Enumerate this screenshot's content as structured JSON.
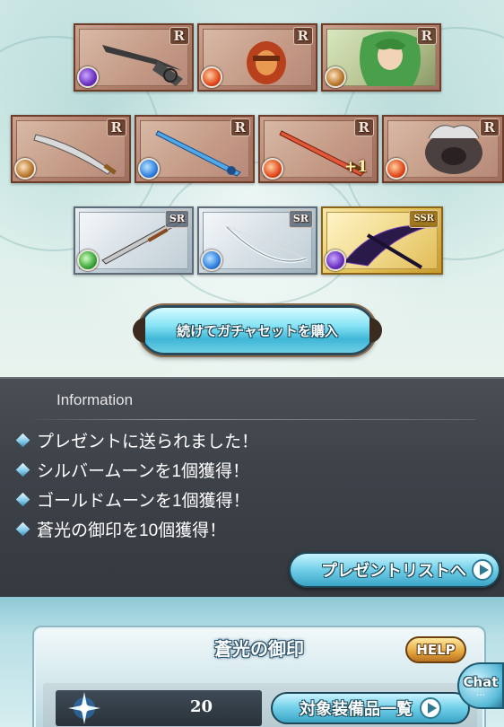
{
  "results": {
    "rows": [
      [
        {
          "rarity": "R",
          "element": "dark",
          "art": "claw-weapon",
          "plus": ""
        },
        {
          "rarity": "R",
          "element": "fire",
          "art": "gauntlet-weapon",
          "plus": ""
        },
        {
          "rarity": "R",
          "element": "earth",
          "art": "character-portrait",
          "plus": ""
        }
      ],
      [
        {
          "rarity": "R",
          "element": "earth",
          "art": "curved-sword",
          "plus": ""
        },
        {
          "rarity": "R",
          "element": "water",
          "art": "blue-sword",
          "plus": ""
        },
        {
          "rarity": "R",
          "element": "fire",
          "art": "red-sword",
          "plus": "+1"
        },
        {
          "rarity": "R",
          "element": "fire",
          "art": "beast-summon",
          "plus": ""
        }
      ],
      [
        {
          "rarity": "SR",
          "element": "wind",
          "art": "long-sword",
          "plus": ""
        },
        {
          "rarity": "SR",
          "element": "water",
          "art": "bow-weapon",
          "plus": ""
        },
        {
          "rarity": "SSR",
          "element": "dark",
          "art": "dark-scythe",
          "plus": ""
        }
      ]
    ],
    "buy_again_label": "続けてガチャセットを購入"
  },
  "information": {
    "title": "Information",
    "items": [
      "プレゼントに送られました！",
      "シルバームーンを1個獲得！",
      "ゴールドムーンを1個獲得！",
      "蒼光の御印を10個獲得！"
    ],
    "present_list_label": "プレゼントリストへ"
  },
  "item_panel": {
    "title": "蒼光の御印",
    "help_label": "HELP",
    "count": "20",
    "equip_list_label": "対象装備品一覧",
    "icon": "star-seal-icon"
  },
  "chat": {
    "label": "Chat"
  },
  "colors": {
    "info_bg": "#3e4249",
    "button_accent": "#70cfe8",
    "help_accent": "#e3a53c"
  }
}
